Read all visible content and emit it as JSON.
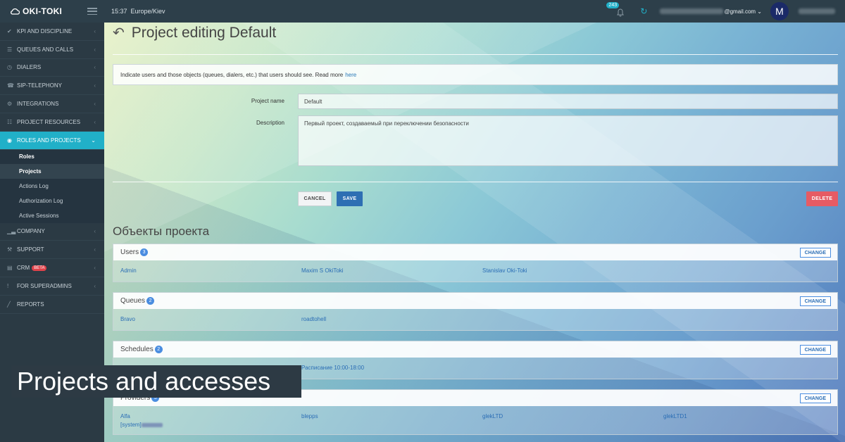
{
  "topbar": {
    "logo": "OKI-TOKI",
    "time": "15:37",
    "timezone": "Europe/Kiev",
    "notifications_count": "243",
    "email_suffix": "@gmail.com",
    "avatar_initial": "M"
  },
  "sidebar": {
    "items_top": [
      {
        "label": "KPI AND DISCIPLINE",
        "icon": "check-icon"
      },
      {
        "label": "QUEUES AND CALLS",
        "icon": "list-icon"
      },
      {
        "label": "DIALERS",
        "icon": "clock-icon"
      },
      {
        "label": "SIP-TELEPHONY",
        "icon": "phone-icon"
      },
      {
        "label": "INTEGRATIONS",
        "icon": "gears-icon"
      },
      {
        "label": "PROJECT RESOURCES",
        "icon": "grid-icon"
      },
      {
        "label": "ROLES AND PROJECTS",
        "icon": "toggle-icon"
      }
    ],
    "sub_items": [
      "Roles",
      "Projects",
      "Actions Log",
      "Authorization Log",
      "Active Sessions"
    ],
    "items_bottom": [
      {
        "label": "COMPANY",
        "icon": "chart-icon"
      },
      {
        "label": "SUPPORT",
        "icon": "wrench-icon"
      },
      {
        "label": "CRM",
        "icon": "crm-icon",
        "badge": "BETA"
      },
      {
        "label": "FOR SUPERADMINS",
        "icon": "exclamation-icon"
      },
      {
        "label": "REPORTS",
        "icon": "line-chart-icon"
      }
    ]
  },
  "page": {
    "title": "Project editing Default",
    "info_text": "Indicate users and those objects (queues, dialers, etc.) that users should see. Read more",
    "info_link": "here",
    "project_name_label": "Project name",
    "project_name_value": "Default",
    "description_label": "Description",
    "description_value": "Первый проект, создаваемый при переключении безопасности",
    "cancel_label": "CANCEL",
    "save_label": "SAVE",
    "delete_label": "DELETE",
    "objects_title": "Объекты проекта",
    "change_label": "CHANGE"
  },
  "panels": {
    "users": {
      "title": "Users",
      "count": "3",
      "items": [
        "Admin",
        "Maxim S OkiToki",
        "Stanislav Oki-Toki"
      ]
    },
    "queues": {
      "title": "Queues",
      "count": "2",
      "items": [
        "Bravo",
        "roadtohell"
      ]
    },
    "schedules": {
      "title": "Schedules",
      "count": "2",
      "items": [
        "Расписание 10:00-18:00"
      ]
    },
    "providers": {
      "title": "Providers",
      "count": "5",
      "items": [
        "Alfa",
        "blepps",
        "glekLTD",
        "glekLTD1"
      ],
      "extra": "[system]"
    }
  },
  "caption": "Projects and accesses",
  "colors": {
    "accent": "#21b0c8",
    "save": "#2e6fb3",
    "delete": "#e65b64",
    "sidebar": "#2b3a44"
  }
}
